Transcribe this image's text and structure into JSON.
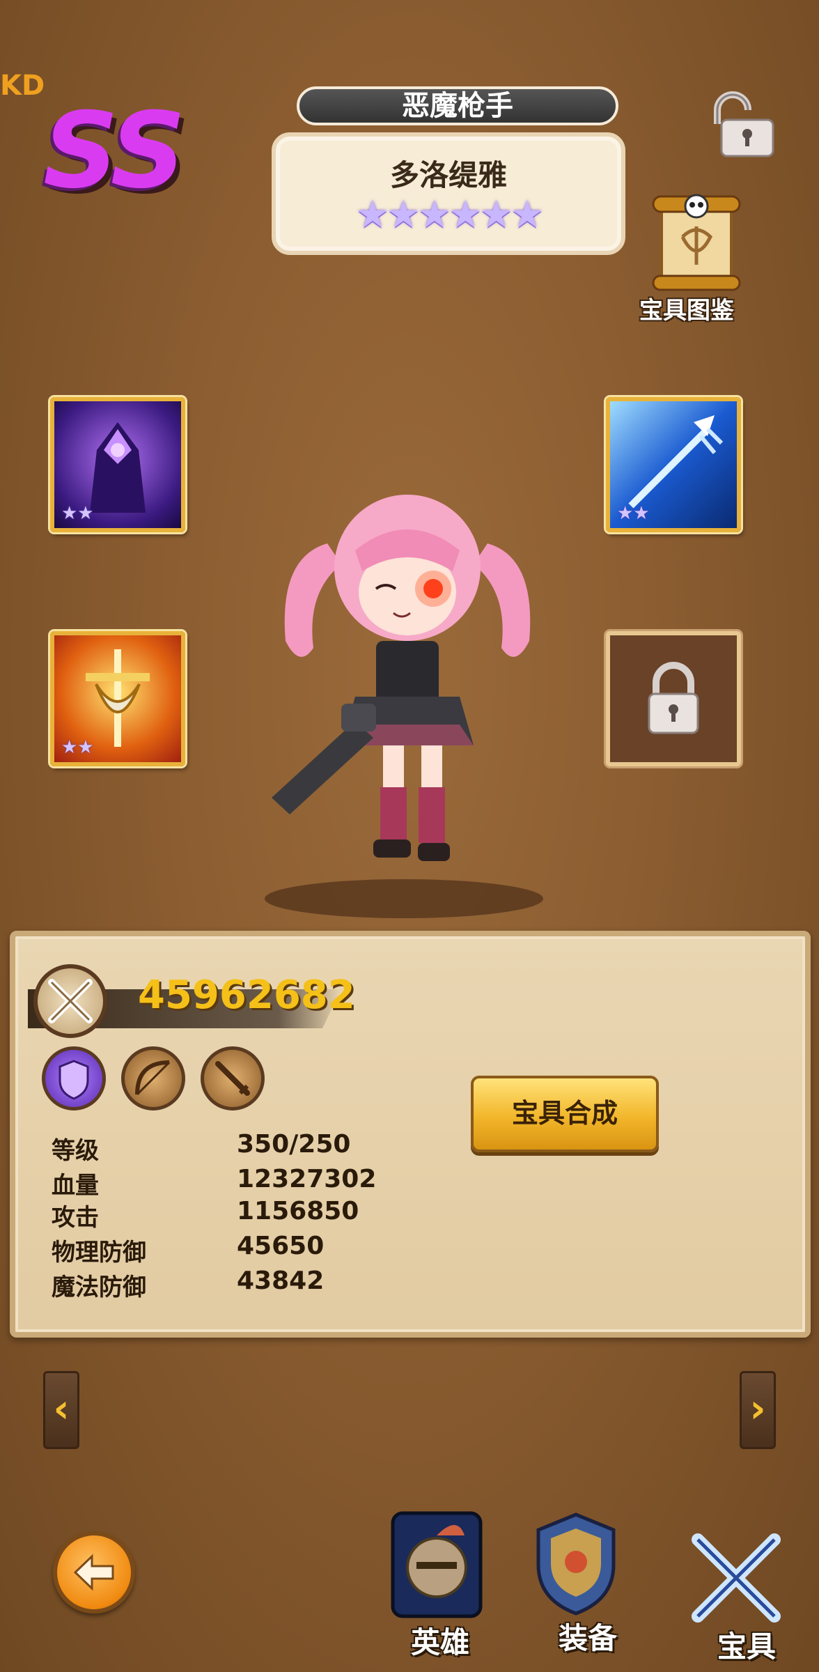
{
  "corner_fragment": "KD",
  "rank": "SS",
  "hero": {
    "class_title": "恶魔枪手",
    "name": "多洛缇雅",
    "star_count": 6,
    "stars_text": "★★★★★★"
  },
  "codex": {
    "label": "宝具图鉴",
    "icon": "scroll-skull-icon"
  },
  "lock_icon": "padlock-icon",
  "skill_slots": [
    {
      "icon": "dark-hooded-mage-icon",
      "stars_text": "★★",
      "locked": false
    },
    {
      "icon": "ice-trident-icon",
      "stars_text": "★★",
      "locked": false
    },
    {
      "icon": "golden-sword-shield-icon",
      "stars_text": "★★",
      "locked": false
    },
    {
      "icon": "padlock-icon",
      "stars_text": "",
      "locked": true
    }
  ],
  "power": {
    "icon": "crossed-swords-icon",
    "value": "45962682"
  },
  "attribute_icons": [
    "magic-shield-icon",
    "bow-icon",
    "sword-icon"
  ],
  "stats": [
    {
      "label": "等级",
      "value": "350/250"
    },
    {
      "label": "血量",
      "value": "12327302"
    },
    {
      "label": "攻击",
      "value": "1156850"
    },
    {
      "label": "物理防御",
      "value": "45650"
    },
    {
      "label": "魔法防御",
      "value": "43842"
    }
  ],
  "synthesis_button": "宝具合成",
  "arrows": {
    "left": "‹",
    "right": "›"
  },
  "bottom_nav": [
    {
      "label": "英雄",
      "icon": "knight-helmet-icon"
    },
    {
      "label": "装备",
      "icon": "armor-shield-icon"
    },
    {
      "label": "宝具",
      "icon": "crossed-blades-icon"
    }
  ],
  "colors": {
    "rank": "#d93cf0",
    "power": "#f5c018",
    "button": "#f2b62a",
    "background": "#8a5c30"
  }
}
